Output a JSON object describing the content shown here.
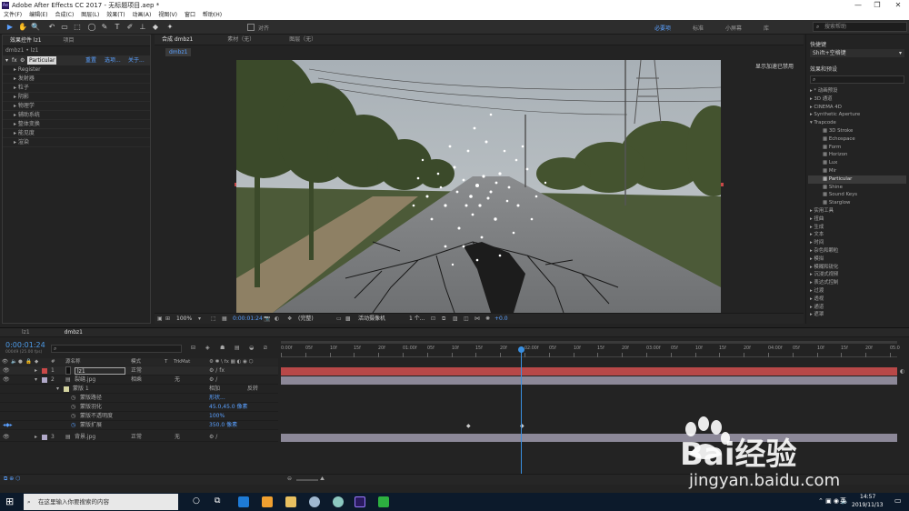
{
  "window": {
    "title": "Adobe After Effects CC 2017 - 无标题项目.aep *",
    "app_icon": "Ae",
    "controls": [
      "—",
      "❐",
      "✕"
    ]
  },
  "menu": [
    "文件(F)",
    "编辑(E)",
    "合成(C)",
    "图层(L)",
    "效果(T)",
    "动画(A)",
    "视图(V)",
    "窗口",
    "帮助(H)"
  ],
  "toolbar": {
    "tools": [
      "▶",
      "✋",
      "🔍",
      "↶",
      "▭",
      "⬚",
      "◯",
      "✎",
      "T",
      "✐",
      "⊥",
      "◆",
      "✦"
    ],
    "align_label": "对齐",
    "workspaces": [
      "必要项",
      "标准",
      "小屏幕",
      "库"
    ],
    "active_workspace": "必要项",
    "help_placeholder": "搜索帮助"
  },
  "effect_controls": {
    "tabs": [
      "效果控件 lz1",
      "项目"
    ],
    "breadcrumb": "dmbz1 • lz1",
    "effect_name": "Particular",
    "effect_links": [
      "重置",
      "选项...",
      "关于..."
    ],
    "groups": [
      "Register",
      "发射器",
      "粒子",
      "阴影",
      "物理学",
      "辅助系统",
      "整体变换",
      "能见度",
      "渲染"
    ]
  },
  "composition": {
    "tabs": [
      "合成 dmbz1",
      "素材（无）",
      "图层（无）"
    ],
    "comp_tag": "dmbz1",
    "overlay_text": "显示加速已禁用",
    "zoom": "100%",
    "timecode": "0:00:01:24",
    "resolution": "(完整)",
    "camera": "活动摄像机",
    "views": "1 个...",
    "exposure": "+0.0"
  },
  "right_panel": {
    "shortcut_tab": "快捷键",
    "shortcut_value": "Shift+空格键",
    "effects_tab": "效果和预设",
    "search_placeholder": "",
    "tree": [
      {
        "label": "* 动画预设",
        "depth": 0,
        "expanded": false
      },
      {
        "label": "3D 通道",
        "depth": 0,
        "expanded": false
      },
      {
        "label": "CINEMA 4D",
        "depth": 0,
        "expanded": false
      },
      {
        "label": "Synthetic Aperture",
        "depth": 0,
        "expanded": false
      },
      {
        "label": "Trapcode",
        "depth": 0,
        "expanded": true
      },
      {
        "label": "3D Stroke",
        "depth": 1
      },
      {
        "label": "Echospace",
        "depth": 1
      },
      {
        "label": "Form",
        "depth": 1
      },
      {
        "label": "Horizon",
        "depth": 1
      },
      {
        "label": "Lux",
        "depth": 1
      },
      {
        "label": "Mir",
        "depth": 1
      },
      {
        "label": "Particular",
        "depth": 1,
        "selected": true
      },
      {
        "label": "Shine",
        "depth": 1
      },
      {
        "label": "Sound Keys",
        "depth": 1
      },
      {
        "label": "Starglow",
        "depth": 1
      },
      {
        "label": "实用工具",
        "depth": 0,
        "expanded": false
      },
      {
        "label": "扭曲",
        "depth": 0,
        "expanded": false
      },
      {
        "label": "生成",
        "depth": 0,
        "expanded": false
      },
      {
        "label": "文本",
        "depth": 0,
        "expanded": false
      },
      {
        "label": "时间",
        "depth": 0,
        "expanded": false
      },
      {
        "label": "杂色和颗粒",
        "depth": 0,
        "expanded": false
      },
      {
        "label": "模拟",
        "depth": 0,
        "expanded": false
      },
      {
        "label": "模糊和锐化",
        "depth": 0,
        "expanded": false
      },
      {
        "label": "沉浸式视频",
        "depth": 0,
        "expanded": false
      },
      {
        "label": "表达式控制",
        "depth": 0,
        "expanded": false
      },
      {
        "label": "过渡",
        "depth": 0,
        "expanded": false
      },
      {
        "label": "透视",
        "depth": 0,
        "expanded": false
      },
      {
        "label": "通道",
        "depth": 0,
        "expanded": false
      },
      {
        "label": "遮罩",
        "depth": 0,
        "expanded": false
      }
    ]
  },
  "timeline": {
    "tabs": [
      "lz1",
      "dmbz1"
    ],
    "timecode": "0:00:01:24",
    "frame_sub": "00049 (25.00 fps)",
    "search_placeholder": "",
    "columns": {
      "source": "源名称",
      "mode": "模式",
      "t": "T",
      "trkmat": "TrkMat"
    },
    "ruler": [
      "0:00f",
      "05f",
      "10f",
      "15f",
      "20f",
      "01:00f",
      "05f",
      "10f",
      "15f",
      "20f",
      "02:00f",
      "05f",
      "10f",
      "15f",
      "20f",
      "03:00f",
      "05f",
      "10f",
      "15f",
      "20f",
      "04:00f",
      "05f",
      "10f",
      "15f",
      "20f",
      "05:0"
    ],
    "playhead_fraction": 0.39,
    "layers": [
      {
        "num": "1",
        "name": "lz1",
        "mode": "正常",
        "trkmat": "",
        "color": "#c94848"
      },
      {
        "num": "2",
        "name": "裂缝.jpg",
        "mode": "相乘",
        "trkmat": "无",
        "color": "#b0a8c8"
      },
      {
        "num": "3",
        "name": "背景.jpg",
        "mode": "正常",
        "trkmat": "无",
        "color": "#b0a8c8"
      }
    ],
    "mask": {
      "name": "蒙版 1",
      "mode": "相加",
      "invert": "反转",
      "props": [
        {
          "label": "蒙版路径",
          "value": "形状..."
        },
        {
          "label": "蒙版羽化",
          "value": "45.0,45.0 像素"
        },
        {
          "label": "蒙版不透明度",
          "value": "100%"
        },
        {
          "label": "蒙版扩展",
          "value": "350.0 像素"
        }
      ]
    }
  },
  "taskbar": {
    "search_placeholder": "在这里输入你要搜索的内容",
    "time": "14:57",
    "date": "2019/11/13",
    "ime": "英"
  },
  "watermark": {
    "brand": "Bai经验",
    "url": "jingyan.baidu.com"
  },
  "colors": {
    "accent": "#5aa0ff",
    "layer_red": "#c94848",
    "layer_purple": "#b0a8c8",
    "playhead": "#3a8fe0",
    "timecode": "#4d9be8"
  }
}
